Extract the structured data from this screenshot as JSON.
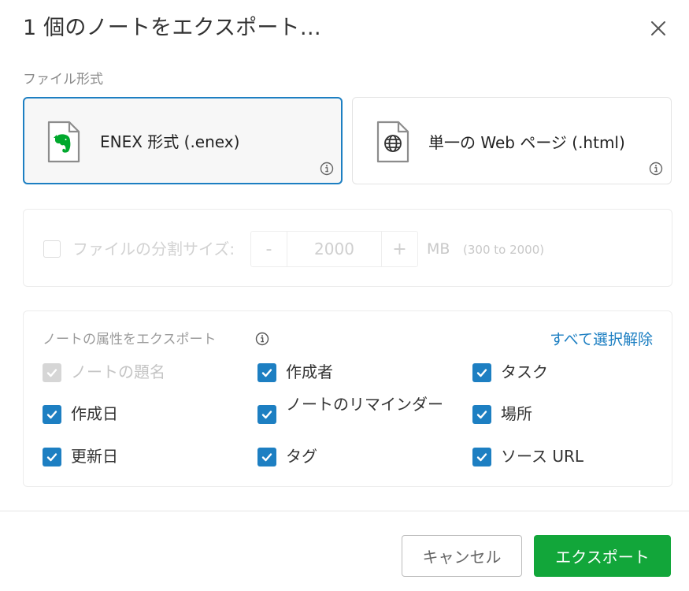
{
  "dialog": {
    "title": "1 個のノートをエクスポート…",
    "close_icon": "close-icon"
  },
  "file_format": {
    "section_label": "ファイル形式",
    "options": [
      {
        "label": "ENEX 形式 (.enex)",
        "icon": "evernote-file-icon",
        "selected": true
      },
      {
        "label": "単一の Web ページ (.html)",
        "icon": "globe-file-icon",
        "selected": false
      }
    ],
    "info_icon": "info-icon"
  },
  "split": {
    "label": "ファイルの分割サイズ:",
    "checked": false,
    "minus_label": "-",
    "value": "2000",
    "plus_label": "+",
    "unit": "MB",
    "range": "(300 to 2000)"
  },
  "attributes": {
    "title": "ノートの属性をエクスポート",
    "deselect_all": "すべて選択解除",
    "items": [
      {
        "label": "ノートの題名",
        "checked": true,
        "disabled": true
      },
      {
        "label": "作成者",
        "checked": true,
        "disabled": false
      },
      {
        "label": "タスク",
        "checked": true,
        "disabled": false
      },
      {
        "label": "作成日",
        "checked": true,
        "disabled": false
      },
      {
        "label": "ノートのリマインダー",
        "checked": true,
        "disabled": false
      },
      {
        "label": "場所",
        "checked": true,
        "disabled": false
      },
      {
        "label": "更新日",
        "checked": true,
        "disabled": false
      },
      {
        "label": "タグ",
        "checked": true,
        "disabled": false
      },
      {
        "label": "ソース URL",
        "checked": true,
        "disabled": false
      }
    ]
  },
  "footer": {
    "cancel_label": "キャンセル",
    "export_label": "エクスポート"
  },
  "colors": {
    "accent_blue": "#1d7fc2",
    "export_green": "#12a63a",
    "evernote_green": "#00a82d",
    "disabled_gray": "#d6d6d6"
  }
}
